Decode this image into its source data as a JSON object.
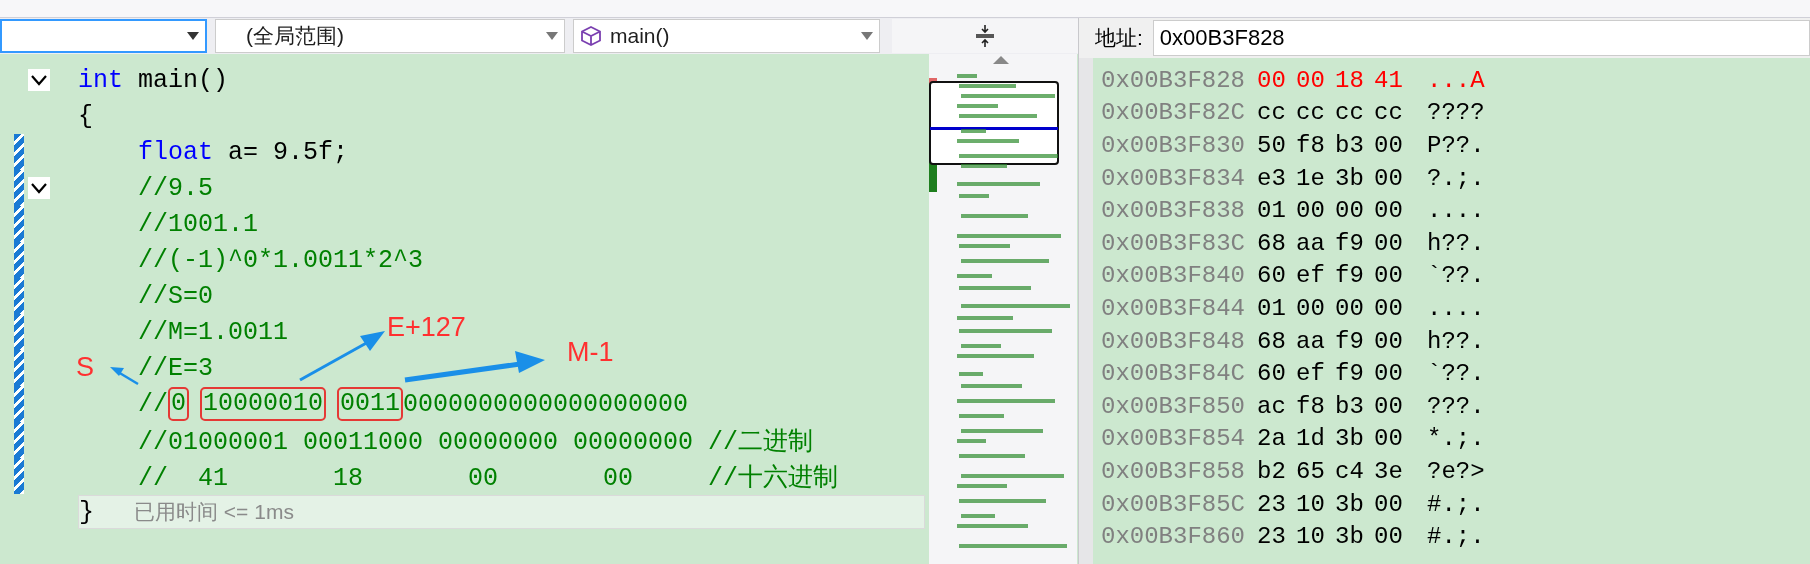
{
  "toolbar": {
    "project_dropdown": {
      "selected": true
    },
    "scope_dropdown": {
      "value": "(全局范围)"
    },
    "function_dropdown": {
      "value": "main()"
    }
  },
  "code": {
    "lines": [
      {
        "segments": [
          {
            "text": "int",
            "kind": "keyword"
          },
          {
            "text": " main()",
            "kind": "plain"
          }
        ],
        "fold": true
      },
      {
        "segments": [
          {
            "text": "{",
            "kind": "plain"
          }
        ],
        "children": [
          {
            "segments": [
              {
                "text": "float",
                "kind": "keyword"
              },
              {
                "text": " a= 9.5f;",
                "kind": "plain"
              }
            ],
            "changed": true
          },
          {
            "segments": [
              {
                "text": "//9.5",
                "kind": "comment"
              }
            ],
            "fold": true,
            "changed": true
          },
          {
            "segments": [
              {
                "text": "//1001.1",
                "kind": "comment"
              }
            ],
            "changed": true
          },
          {
            "segments": [
              {
                "text": "//(-1)^0*1.0011*2^3",
                "kind": "comment"
              }
            ],
            "changed": true
          },
          {
            "segments": [
              {
                "text": "//S=0",
                "kind": "comment"
              }
            ],
            "changed": true
          },
          {
            "segments": [
              {
                "text": "//M=1.0011",
                "kind": "comment"
              }
            ],
            "changed": true
          },
          {
            "segments": [
              {
                "text": "//E=3",
                "kind": "comment"
              }
            ],
            "changed": true
          },
          {
            "segments": [
              {
                "text": "//",
                "kind": "comment"
              },
              {
                "text": "0",
                "kind": "comment",
                "boxed": true
              },
              {
                "text": "10000010",
                "kind": "comment",
                "boxed": true
              },
              {
                "text": "0011",
                "kind": "comment",
                "boxed": true
              },
              {
                "text": "0000000000000000000",
                "kind": "comment"
              }
            ],
            "changed": true
          },
          {
            "segments": [
              {
                "text": "//01000001 00011000 00000000 00000000 //二进制",
                "kind": "comment"
              }
            ],
            "changed": true
          },
          {
            "segments": [
              {
                "text": "//  41       18       00       00     //十六进制",
                "kind": "comment"
              }
            ],
            "changed": true
          }
        ]
      },
      {
        "segments": [
          {
            "text": "}",
            "kind": "plain"
          }
        ],
        "current": true,
        "hint": "已用时间 <= 1ms"
      }
    ],
    "annotations": [
      {
        "label": "S",
        "kind": "sign"
      },
      {
        "label": "E+127",
        "kind": "exponent"
      },
      {
        "label": "M-1",
        "kind": "mantissa"
      }
    ]
  },
  "memory": {
    "address_label": "地址:",
    "address_value": "0x00B3F828",
    "rows": [
      {
        "address": "0x00B3F828",
        "bytes": [
          "00",
          "00",
          "18",
          "41"
        ],
        "ascii": "...A",
        "changed": true
      },
      {
        "address": "0x00B3F82C",
        "bytes": [
          "cc",
          "cc",
          "cc",
          "cc"
        ],
        "ascii": "????",
        "changed": false
      },
      {
        "address": "0x00B3F830",
        "bytes": [
          "50",
          "f8",
          "b3",
          "00"
        ],
        "ascii": "P??.",
        "changed": false
      },
      {
        "address": "0x00B3F834",
        "bytes": [
          "e3",
          "1e",
          "3b",
          "00"
        ],
        "ascii": "?.;.",
        "changed": false
      },
      {
        "address": "0x00B3F838",
        "bytes": [
          "01",
          "00",
          "00",
          "00"
        ],
        "ascii": "....",
        "changed": false
      },
      {
        "address": "0x00B3F83C",
        "bytes": [
          "68",
          "aa",
          "f9",
          "00"
        ],
        "ascii": "h??.",
        "changed": false
      },
      {
        "address": "0x00B3F840",
        "bytes": [
          "60",
          "ef",
          "f9",
          "00"
        ],
        "ascii": "`??.",
        "changed": false
      },
      {
        "address": "0x00B3F844",
        "bytes": [
          "01",
          "00",
          "00",
          "00"
        ],
        "ascii": "....",
        "changed": false
      },
      {
        "address": "0x00B3F848",
        "bytes": [
          "68",
          "aa",
          "f9",
          "00"
        ],
        "ascii": "h??.",
        "changed": false
      },
      {
        "address": "0x00B3F84C",
        "bytes": [
          "60",
          "ef",
          "f9",
          "00"
        ],
        "ascii": "`??.",
        "changed": false
      },
      {
        "address": "0x00B3F850",
        "bytes": [
          "ac",
          "f8",
          "b3",
          "00"
        ],
        "ascii": "???.",
        "changed": false
      },
      {
        "address": "0x00B3F854",
        "bytes": [
          "2a",
          "1d",
          "3b",
          "00"
        ],
        "ascii": "*.;.",
        "changed": false
      },
      {
        "address": "0x00B3F858",
        "bytes": [
          "b2",
          "65",
          "c4",
          "3e"
        ],
        "ascii": "?e?>",
        "changed": false
      },
      {
        "address": "0x00B3F85C",
        "bytes": [
          "23",
          "10",
          "3b",
          "00"
        ],
        "ascii": "#.;.",
        "changed": false
      },
      {
        "address": "0x00B3F860",
        "bytes": [
          "23",
          "10",
          "3b",
          "00"
        ],
        "ascii": "#.;.",
        "changed": false
      }
    ]
  }
}
